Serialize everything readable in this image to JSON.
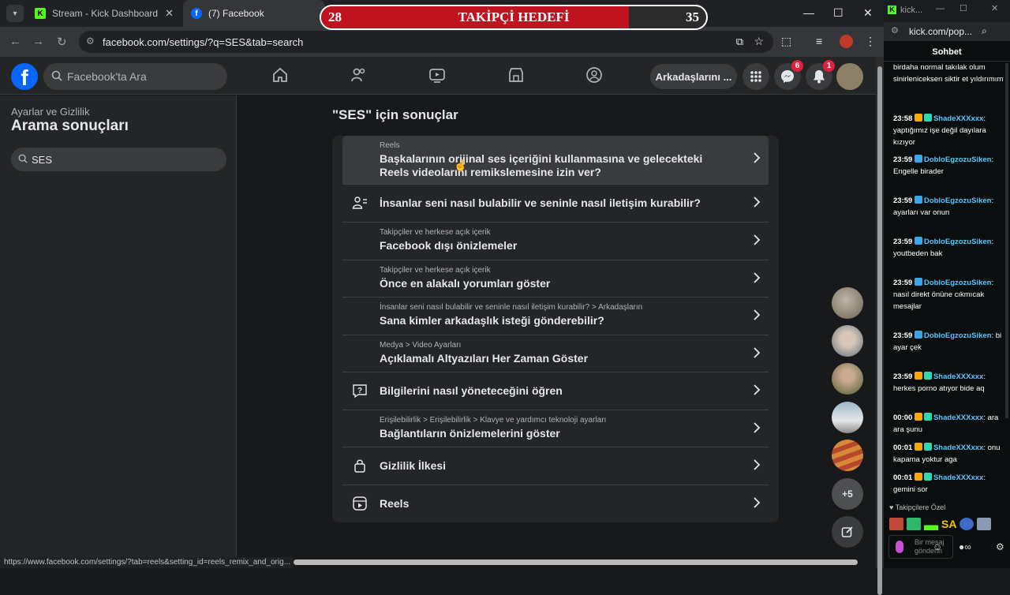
{
  "browser": {
    "tabs": [
      {
        "label": "Stream - Kick Dashboard",
        "icon": "kick-icon"
      },
      {
        "label": "(7) Facebook",
        "icon": "facebook-icon"
      }
    ],
    "url": "facebook.com/settings/?q=SES&tab=search",
    "status_url": "https://www.facebook.com/settings/?tab=reels&setting_id=reels_remix_and_orig..."
  },
  "goal": {
    "current": "28",
    "target": "35",
    "label": "TAKİPÇİ HEDEFİ",
    "progress": 0.8
  },
  "facebook": {
    "search_placeholder": "Facebook'ta Ara",
    "friends_button": "Arkadaşlarını ...",
    "messenger_badge": "6",
    "notif_badge": "1",
    "sidebar": {
      "breadcrumb": "Ayarlar ve Gizlilik",
      "title": "Arama sonuçları",
      "search_value": "SES"
    },
    "results_title": "\"SES\" için sonuçlar",
    "results": [
      {
        "sub": "Reels",
        "main": "Başkalarının orijinal ses içeriğini kullanmasına ve gelecekteki Reels videolarını remikslemesine izin ver?",
        "icon": "none"
      },
      {
        "sub": "",
        "main": "İnsanlar seni nasıl bulabilir ve seninle nasıl iletişim kurabilir?",
        "icon": "people-icon"
      },
      {
        "sub": "Takipçiler ve herkese açık içerik",
        "main": "Facebook dışı önizlemeler",
        "icon": "none"
      },
      {
        "sub": "Takipçiler ve herkese açık içerik",
        "main": "Önce en alakalı yorumları göster",
        "icon": "none"
      },
      {
        "sub": "İnsanlar seni nasıl bulabilir ve seninle nasıl iletişim kurabilir? > Arkadaşların",
        "main": "Sana kimler arkadaşlık isteği gönderebilir?",
        "icon": "none"
      },
      {
        "sub": "Medya > Video Ayarları",
        "main": "Açıklamalı Altyazıları Her Zaman Göster",
        "icon": "none"
      },
      {
        "sub": "",
        "main": "Bilgilerini nasıl yöneteceğini öğren",
        "icon": "help-icon"
      },
      {
        "sub": "Erişilebilirlik > Erişilebilirlik > Klavye ve yardımcı teknoloji ayarları",
        "main": "Bağlantıların önizlemelerini göster",
        "icon": "none"
      },
      {
        "sub": "",
        "main": "Gizlilik İlkesi",
        "icon": "lock-icon"
      },
      {
        "sub": "",
        "main": "Reels",
        "icon": "reels-icon"
      }
    ],
    "contacts_more": "+5"
  },
  "kick": {
    "tab_label": "kick...",
    "url": "kick.com/pop...",
    "chat_title": "Sohbet",
    "messages": [
      {
        "time": "",
        "user": "",
        "text": "birdaha normal takılak olum sinirleniceksen siktir et yıldırımım"
      },
      {
        "time": "23:58",
        "user": "ShadeXXXxxx",
        "text": ": yaptığımız işe değil dayılara kızıyor"
      },
      {
        "time": "23:59",
        "user": "DobloEgzozuSiken",
        "text": ": Engelle birader"
      },
      {
        "time": "23:59",
        "user": "DobloEgzozuSiken",
        "text": ": ayarları var onun"
      },
      {
        "time": "23:59",
        "user": "DobloEgzozuSiken",
        "text": ": youtbeden bak"
      },
      {
        "time": "23:59",
        "user": "DobloEgzozuSiken",
        "text": ": nasıl direkt önüne cıkmıcak mesajlar"
      },
      {
        "time": "23:59",
        "user": "DobloEgzozuSiken",
        "text": ": bi ayar çek"
      },
      {
        "time": "23:59",
        "user": "ShadeXXXxxx",
        "text": ": herkes porno atıyor bide aq"
      },
      {
        "time": "00:00",
        "user": "ShadeXXXxxx",
        "text": ": ara ara şunu"
      },
      {
        "time": "00:01",
        "user": "ShadeXXXxxx",
        "text": ": onu kapama yoktur aga"
      },
      {
        "time": "00:01",
        "user": "ShadeXXXxxx",
        "text": ": gemini sor"
      }
    ],
    "followers_only": "Takipçilere Özel",
    "emote_sa": "SA",
    "input_placeholder": "Bir mesaj gönderin"
  },
  "colors": {
    "fb_blue": "#0866ff",
    "kick_green": "#53fc18",
    "goal_red": "#c1121f"
  }
}
